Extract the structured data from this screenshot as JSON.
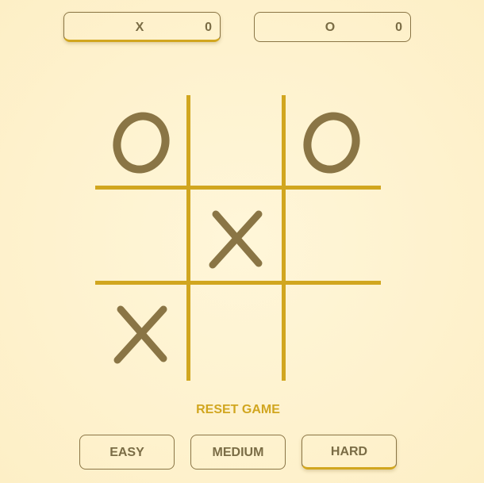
{
  "scoreboard": {
    "x": {
      "label": "X",
      "score": "0"
    },
    "o": {
      "label": "O",
      "score": "0"
    },
    "active": "x"
  },
  "board": {
    "cells": [
      "O",
      "",
      "O",
      "",
      "X",
      "",
      "X",
      "",
      ""
    ]
  },
  "controls": {
    "reset_label": "RESET GAME",
    "levels": [
      "EASY",
      "MEDIUM",
      "HARD"
    ],
    "selected_level": "HARD"
  },
  "colors": {
    "mark": "#8a7545",
    "grid": "#d1a61f",
    "accent": "#d1a61f",
    "text": "#7a6c45"
  }
}
